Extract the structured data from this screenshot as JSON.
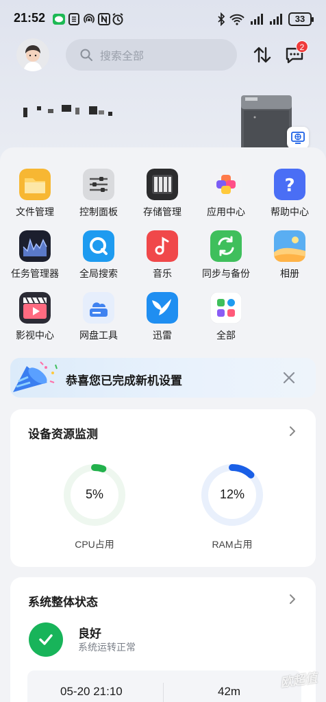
{
  "status_bar": {
    "time": "21:52",
    "battery": "33"
  },
  "header": {
    "search_placeholder": "搜索全部",
    "message_badge": "2"
  },
  "apps": [
    {
      "label": "文件管理",
      "icon": "folder-icon"
    },
    {
      "label": "控制面板",
      "icon": "sliders-icon"
    },
    {
      "label": "存储管理",
      "icon": "storage-icon"
    },
    {
      "label": "应用中心",
      "icon": "app-center-icon"
    },
    {
      "label": "帮助中心",
      "icon": "help-icon"
    },
    {
      "label": "任务管理器",
      "icon": "task-manager-icon"
    },
    {
      "label": "全局搜索",
      "icon": "global-search-icon"
    },
    {
      "label": "音乐",
      "icon": "music-icon"
    },
    {
      "label": "同步与备份",
      "icon": "sync-icon"
    },
    {
      "label": "相册",
      "icon": "photos-icon"
    },
    {
      "label": "影视中心",
      "icon": "video-icon"
    },
    {
      "label": "网盘工具",
      "icon": "cloud-drive-icon"
    },
    {
      "label": "迅雷",
      "icon": "thunder-icon"
    },
    {
      "label": "全部",
      "icon": "all-apps-icon"
    }
  ],
  "banner": {
    "text": "恭喜您已完成新机设置"
  },
  "resource_card": {
    "title": "设备资源监测",
    "cpu": {
      "value": "5%",
      "label": "CPU占用",
      "fraction": 0.05,
      "color": "#22b14c",
      "track": "#eef7ef"
    },
    "ram": {
      "value": "12%",
      "label": "RAM占用",
      "fraction": 0.12,
      "color": "#1a5fe6",
      "track": "#e9f0fc"
    }
  },
  "status_card": {
    "title": "系统整体状态",
    "status": "良好",
    "status_desc": "系统运转正常",
    "stat_time": "05-20 21:10",
    "stat_duration": "42m"
  },
  "watermark": "欧超值"
}
